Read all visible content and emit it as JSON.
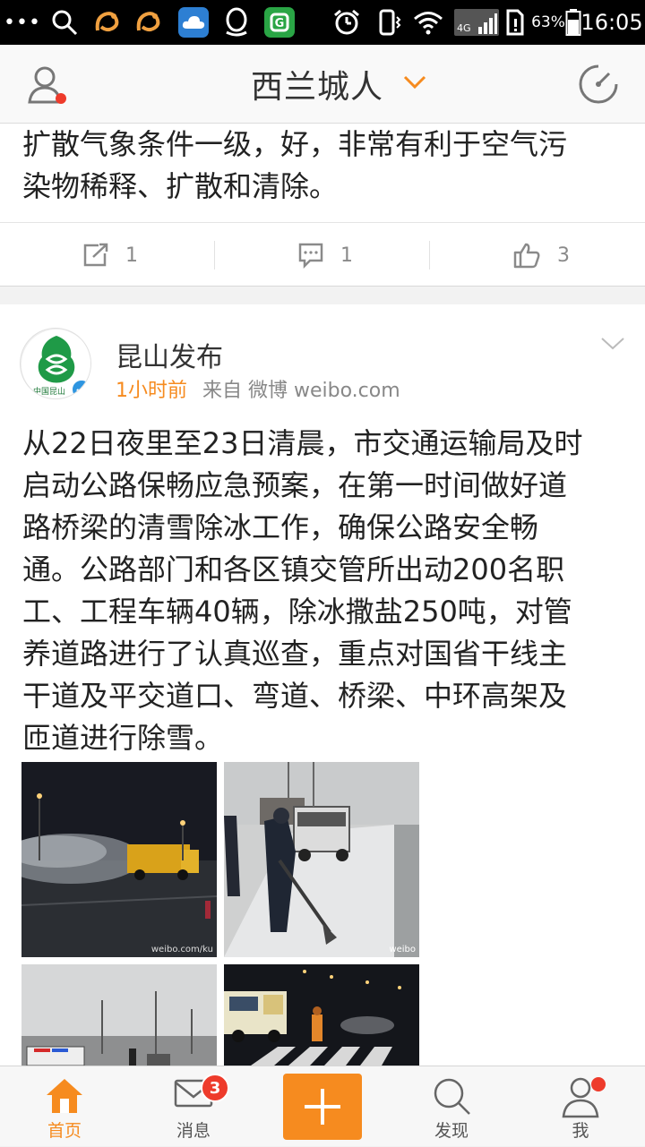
{
  "status_bar": {
    "battery_percent": "63%",
    "time": "16:05",
    "network": "4G"
  },
  "header": {
    "title": "西兰城人"
  },
  "previous_post": {
    "text_line1": "扩散气象条件一级，好，非常有利于空气污",
    "text_line2": "染物稀释、扩散和清除。",
    "repost_count": "1",
    "comment_count": "1",
    "like_count": "3"
  },
  "post": {
    "author": "昆山发布",
    "time": "1小时前",
    "source": "来自 微博 weibo.com",
    "avatar_caption": "中国昆山",
    "text_lines": [
      "从22日夜里至23日清晨，市交通运输局及时",
      "启动公路保畅应急预案，在第一时间做好道",
      "路桥梁的清雪除冰工作，确保公路安全畅",
      "通。公路部门和各区镇交管所出动200名职",
      "工、工程车辆40辆，除冰撒盐250吨，对管",
      "养道路进行了认真巡查，重点对国省干线主",
      "干道及平交道口、弯道、桥梁、中环高架及",
      "匝道进行除雪。"
    ],
    "photo_watermark": "weibo.com/ku"
  },
  "tabbar": {
    "items": [
      {
        "label": "首页",
        "icon": "home-icon"
      },
      {
        "label": "消息",
        "icon": "envelope-icon",
        "badge": "3"
      },
      {
        "label": "",
        "icon": "plus-icon"
      },
      {
        "label": "发现",
        "icon": "search-icon"
      },
      {
        "label": "我",
        "icon": "person-icon"
      }
    ]
  },
  "colors": {
    "accent": "#f68b1f",
    "badge": "#ee3b2b",
    "home_active": "#f68b1f"
  }
}
